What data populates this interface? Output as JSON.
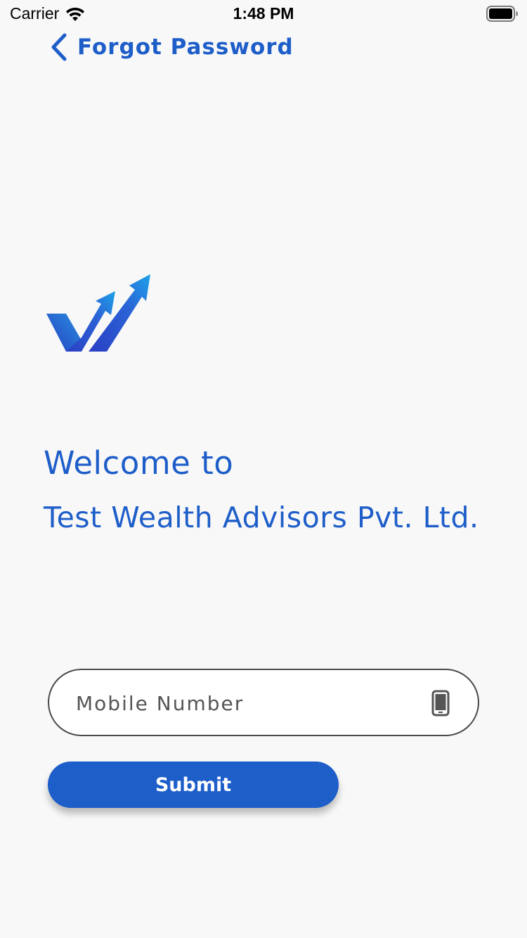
{
  "status_bar": {
    "carrier": "Carrier",
    "time": "1:48 PM",
    "icons": [
      "wifi-icon",
      "battery-icon"
    ]
  },
  "nav": {
    "title": "Forgot Password",
    "back_icon": "chevron-left-icon"
  },
  "welcome": {
    "line1": "Welcome to",
    "company": "Test Wealth Advisors Pvt. Ltd."
  },
  "form": {
    "mobile_placeholder": "Mobile Number",
    "mobile_value": "",
    "mobile_icon": "phone-icon",
    "submit_label": "Submit"
  },
  "colors": {
    "accent": "#1e5ec9",
    "background": "#f8f8f8",
    "field_border": "#4a4a4a"
  }
}
